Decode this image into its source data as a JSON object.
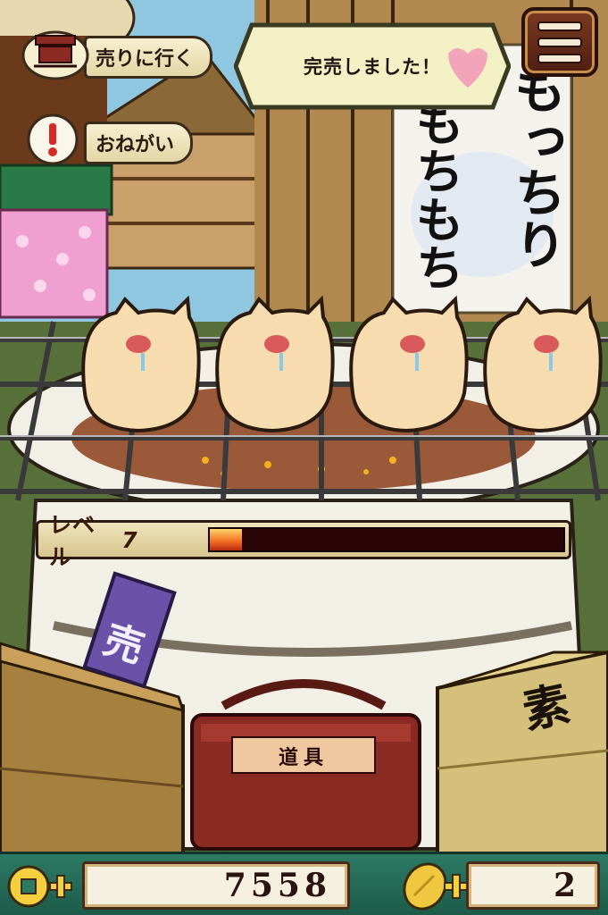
{
  "menu": {
    "go_sell_label": "売りに行く",
    "request_label": "おねがい"
  },
  "notice": {
    "text": "完売しました！"
  },
  "banner": {
    "line1": "もっちり",
    "line2": "もちもち"
  },
  "level": {
    "label": "レベル",
    "value": "7",
    "progress": 0.09
  },
  "bins": {
    "sell_tag": "売",
    "tools_label": "道具",
    "ingredients_tag": "素"
  },
  "status": {
    "money": "7558",
    "tickets": "2"
  },
  "colors": {
    "accent_green": "#2d7a64",
    "wood": "#b08850",
    "level_fill": "#f06a20"
  }
}
